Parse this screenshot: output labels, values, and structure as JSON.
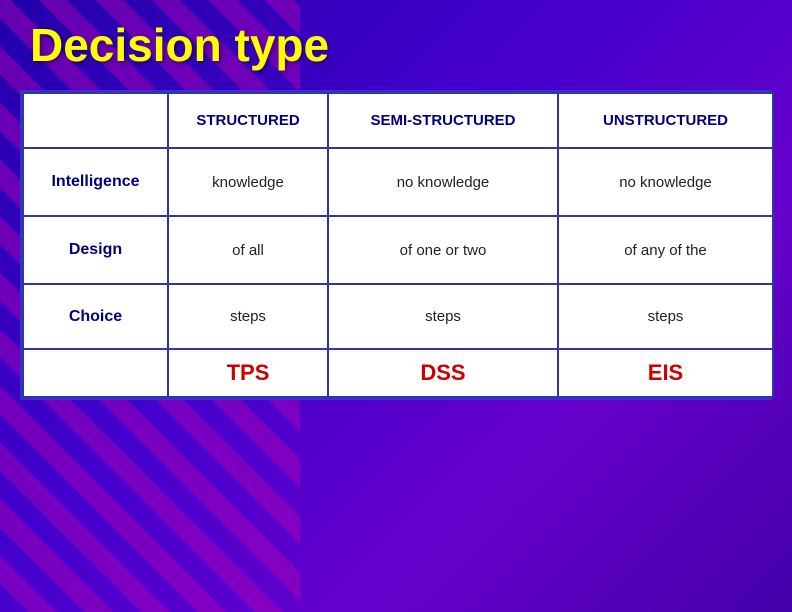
{
  "title": "Decision type",
  "table": {
    "header": {
      "col0": "",
      "col1": "STRUCTURED",
      "col2": "SEMI-STRUCTURED",
      "col3": "UNSTRUCTURED"
    },
    "rows": [
      {
        "label": "Intelligence",
        "col1": "knowledge",
        "col2": "no knowledge",
        "col3": "no knowledge"
      },
      {
        "label": "Design",
        "col1": "of all",
        "col2": "of one or two",
        "col3": "of any of the"
      },
      {
        "label": "Choice",
        "col1": "steps",
        "col2": "steps",
        "col3": "steps"
      }
    ],
    "footer": {
      "col0": "",
      "col1": "TPS",
      "col2": "DSS",
      "col3": "EIS"
    }
  }
}
